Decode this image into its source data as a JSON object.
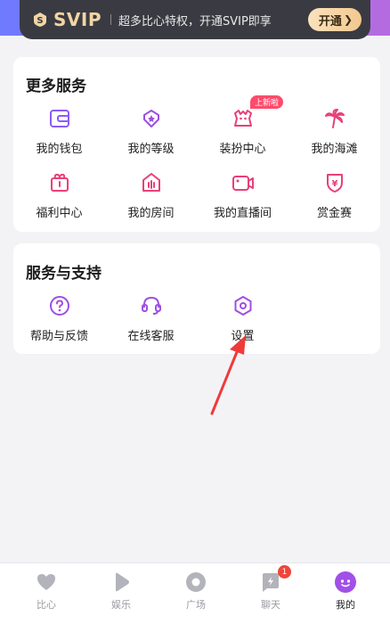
{
  "vip_banner": {
    "title": "SVIP",
    "description": "超多比心特权，开通SVIP即享",
    "button_label": "开通"
  },
  "more_services": {
    "title": "更多服务",
    "items": [
      {
        "label": "我的钱包",
        "icon": "wallet-icon"
      },
      {
        "label": "我的等级",
        "icon": "level-icon"
      },
      {
        "label": "装扮中心",
        "icon": "dressup-icon",
        "badge": "上新啦"
      },
      {
        "label": "我的海滩",
        "icon": "palm-tree-icon"
      },
      {
        "label": "福利中心",
        "icon": "gift-box-icon"
      },
      {
        "label": "我的房间",
        "icon": "room-icon"
      },
      {
        "label": "我的直播间",
        "icon": "live-camera-icon"
      },
      {
        "label": "赏金赛",
        "icon": "bounty-shield-icon"
      }
    ]
  },
  "support": {
    "title": "服务与支持",
    "items": [
      {
        "label": "帮助与反馈",
        "icon": "help-icon"
      },
      {
        "label": "在线客服",
        "icon": "headset-icon"
      },
      {
        "label": "设置",
        "icon": "settings-icon"
      }
    ]
  },
  "tabbar": {
    "items": [
      {
        "label": "比心",
        "icon": "heart-icon"
      },
      {
        "label": "娱乐",
        "icon": "play-icon"
      },
      {
        "label": "广场",
        "icon": "square-icon"
      },
      {
        "label": "聊天",
        "icon": "chat-icon",
        "badge": "1"
      },
      {
        "label": "我的",
        "icon": "profile-icon"
      }
    ]
  },
  "colors": {
    "accent": "#a150e8",
    "pink": "#e8407a",
    "vip_gold": "#f2d5a3",
    "badge_red": "#f0453a",
    "annotation_arrow": "#f03a3a"
  }
}
